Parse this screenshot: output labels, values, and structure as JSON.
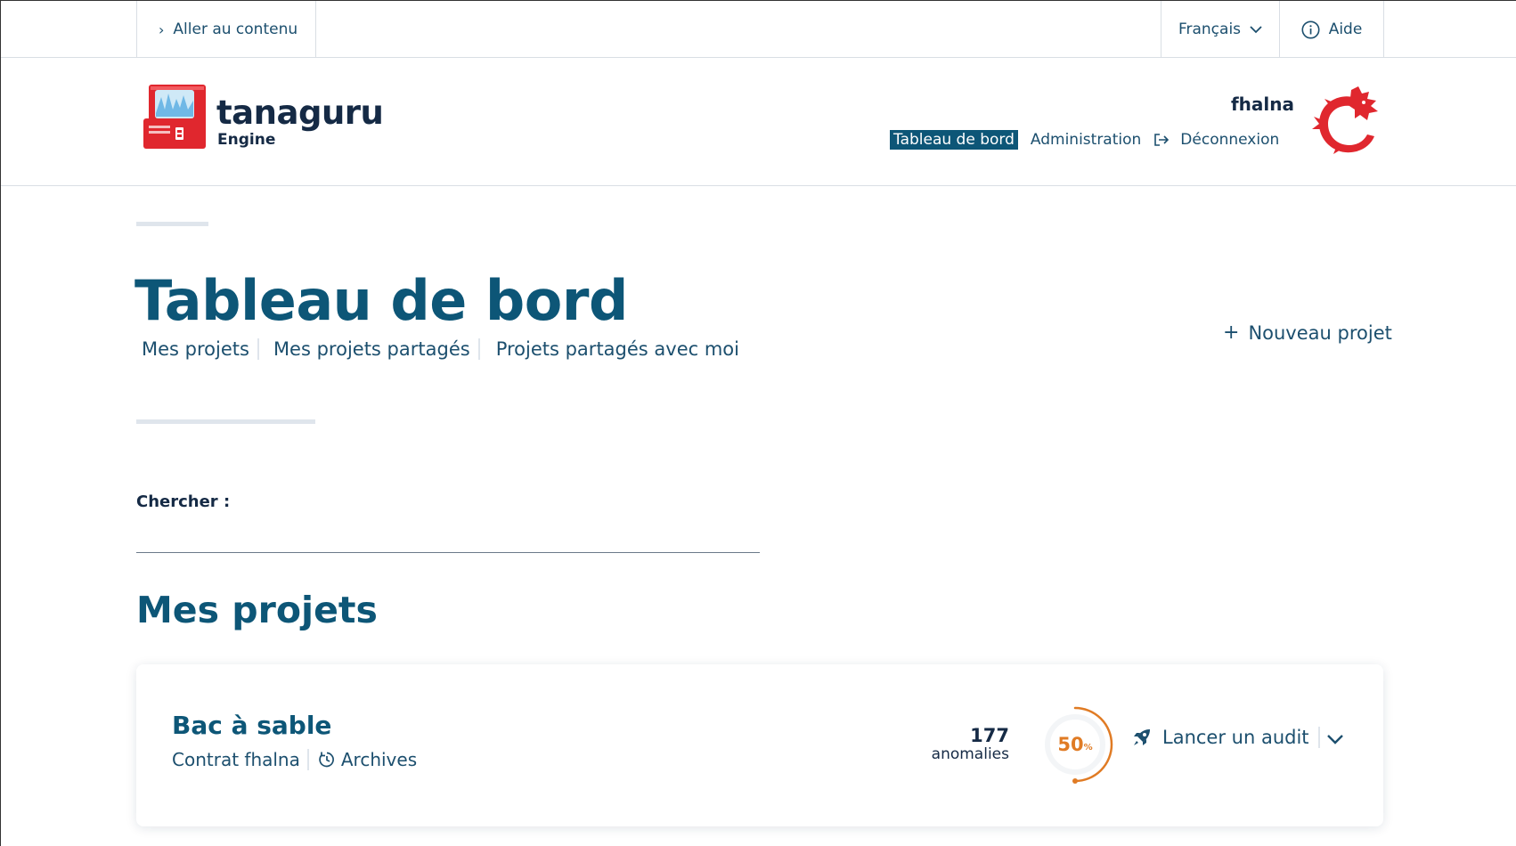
{
  "topbar": {
    "skip_link": "Aller au contenu",
    "language": "Français",
    "help": "Aide"
  },
  "header": {
    "logo_text": "tanaguru",
    "logo_sub": "Engine",
    "username": "fhalna",
    "nav": {
      "dashboard": "Tableau de bord",
      "admin": "Administration",
      "logout": "Déconnexion"
    }
  },
  "main": {
    "title": "Tableau de bord",
    "tabs": [
      "Mes projets",
      "Mes projets partagés",
      "Projets partagés avec moi"
    ],
    "new_project": "Nouveau projet",
    "search_label": "Chercher :",
    "search_value": "",
    "section_title": "Mes projets"
  },
  "project": {
    "name": "Bac à sable",
    "contract": "Contrat fhalna",
    "archives": "Archives",
    "anomalies_count": "177",
    "anomalies_label": "anomalies",
    "score": "50",
    "score_unit": "%",
    "score_fraction": 0.5,
    "launch_audit": "Lancer un audit"
  },
  "colors": {
    "primary": "#0d5677",
    "text": "#1c4f6e",
    "dark": "#152a45",
    "score_orange": "#e07b24",
    "logo_red": "#e0272e"
  }
}
